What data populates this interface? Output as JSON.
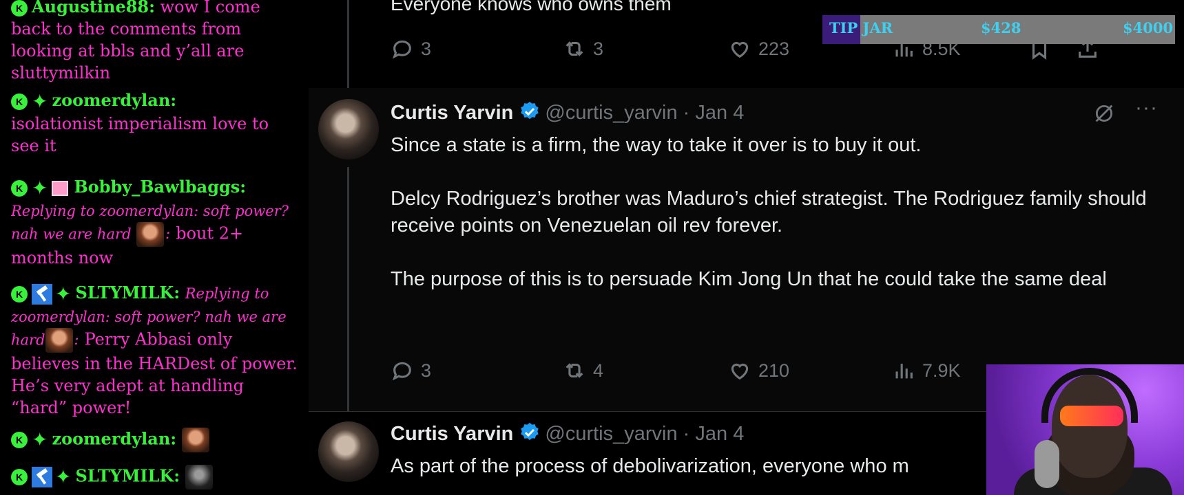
{
  "chat": {
    "messages": [
      {
        "user": "Augustine88:",
        "text": "wow I come back to the comments from looking at bbls and y’all are sluttymilkin"
      },
      {
        "user": "zoomerdylan:",
        "text": "isolationist imperialism love to see it"
      },
      {
        "user": "Bobby_Bawlbaggs:",
        "reply": "Replying to zoomerdylan: soft power? nah we are hard",
        "text": "bout 2+ months now"
      },
      {
        "user": "SLTYMILK:",
        "reply_a": "Replying to zoomerdylan: soft power? nah we are",
        "reply_b": "hard",
        "text": "Perry Abbasi only believes in the HARDest of power. He’s very adept at handling “hard” power!"
      },
      {
        "user": "zoomerdylan:"
      },
      {
        "user": "SLTYMILK:"
      }
    ],
    "badge_letter": "K",
    "sparkle": "✦"
  },
  "feed": {
    "prev_tweet": {
      "text_tail": "Everyone knows who owns them",
      "replies": "3",
      "reposts": "3",
      "likes": "223",
      "views": "8.5K"
    },
    "tweets": [
      {
        "name": "Curtis Yarvin",
        "handle": "@curtis_yarvin",
        "sep": "·",
        "date": "Jan 4",
        "body": "Since a state is a firm, the way to take it over is to buy it out.\n\nDelcy Rodriguez’s brother was Maduro’s chief strategist. The Rodriguez family should receive points on Venezuelan oil rev forever.\n\nThe purpose of this is to persuade Kim Jong Un that he could take the same deal",
        "replies": "3",
        "reposts": "4",
        "likes": "210",
        "views": "7.9K"
      },
      {
        "name": "Curtis Yarvin",
        "handle": "@curtis_yarvin",
        "sep": "·",
        "date": "Jan 4",
        "body": "As part of the process of debolivarization, everyone who m"
      }
    ],
    "more": "···"
  },
  "tipjar": {
    "label": "TIP JAR",
    "current": "$428",
    "goal": "$4000",
    "progress": 0.107
  },
  "colors": {
    "chat_text": "#ff2fd0",
    "chat_user": "#39f03a",
    "verified": "#1d9bf0",
    "tip_text": "#3fd0f0"
  }
}
